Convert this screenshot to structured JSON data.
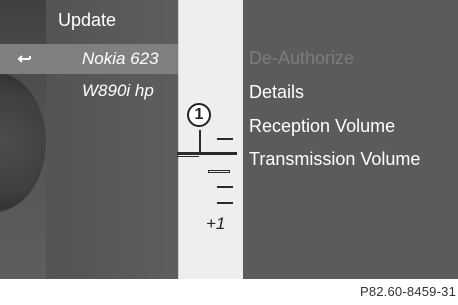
{
  "header": {
    "title": "Update"
  },
  "devices": [
    {
      "label": "Nokia 623",
      "selected": true
    },
    {
      "label": "W890i hp",
      "selected": false
    }
  ],
  "volume_scale": {
    "plus_label": "+1"
  },
  "callout": {
    "number": "1"
  },
  "menu": {
    "items": [
      {
        "label": "De-Authorize",
        "state": "disabled"
      },
      {
        "label": "Details",
        "state": "normal"
      },
      {
        "label": "Reception Volume",
        "state": "normal"
      },
      {
        "label": "Transmission Volume",
        "state": "active"
      }
    ]
  },
  "footer": {
    "ref_code": "P82.60-8459-31"
  },
  "icons": {
    "back": "back-arrow-icon"
  },
  "colors": {
    "selected_row": "#7e8082",
    "band": "#eeeeec",
    "disabled_text": "#7a7c7e"
  }
}
